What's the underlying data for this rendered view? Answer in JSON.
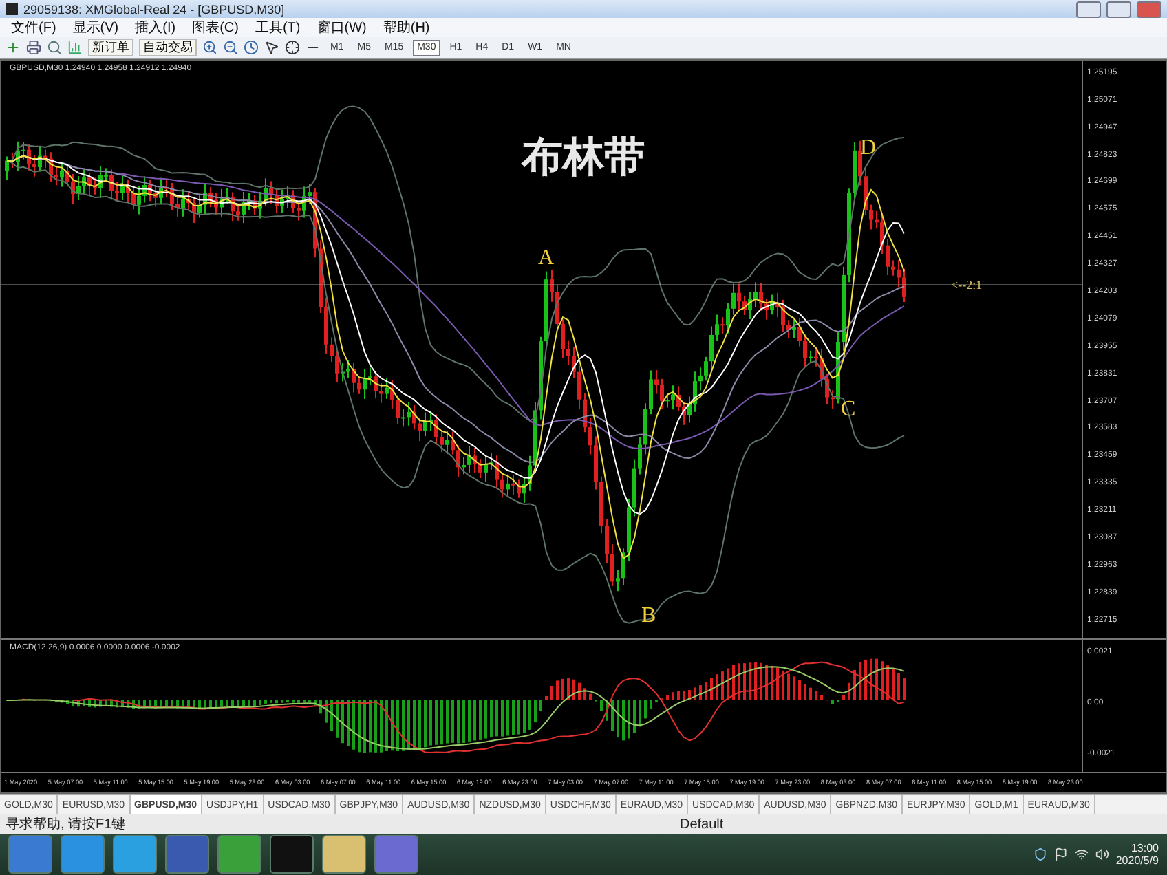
{
  "window": {
    "title": "29059138: XMGlobal-Real 24 - [GBPUSD,M30]"
  },
  "menu": [
    "文件(F)",
    "显示(V)",
    "插入(I)",
    "图表(C)",
    "工具(T)",
    "窗口(W)",
    "帮助(H)"
  ],
  "toolbar": {
    "buttons": [
      {
        "label": "新订单"
      },
      {
        "label": "自动交易"
      }
    ],
    "timeframes": [
      {
        "label": "M1",
        "selected": false
      },
      {
        "label": "M5",
        "selected": false
      },
      {
        "label": "M15",
        "selected": false
      },
      {
        "label": "M30",
        "selected": true
      },
      {
        "label": "H1",
        "selected": false
      },
      {
        "label": "H4",
        "selected": false
      },
      {
        "label": "D1",
        "selected": false
      },
      {
        "label": "W1",
        "selected": false
      },
      {
        "label": "MN",
        "selected": false
      }
    ]
  },
  "chart": {
    "header": "GBPUSD,M30 1.24940 1.24958 1.24912 1.24940",
    "title": "布林带",
    "annotations": [
      {
        "kind": "point",
        "label": "A"
      },
      {
        "kind": "point",
        "label": "B"
      },
      {
        "kind": "point",
        "label": "C"
      },
      {
        "kind": "point",
        "label": "D"
      },
      {
        "kind": "ratio",
        "label": "<--2:1"
      }
    ],
    "price_axis": [
      "1.25195",
      "1.25071",
      "1.24947",
      "1.24823",
      "1.24699",
      "1.24575",
      "1.24451",
      "1.24327",
      "1.24203",
      "1.24079",
      "1.23955",
      "1.23831",
      "1.23707",
      "1.23583",
      "1.23459",
      "1.23335",
      "1.23211",
      "1.23087",
      "1.22963",
      "1.22839",
      "1.22715"
    ],
    "indicator": {
      "header": "MACD(12,26,9) 0.0006 0.0000 0.0006 -0.0002",
      "axis": [
        "0.0021",
        "0.00",
        "-0.0021"
      ]
    },
    "time_axis": [
      "1 May 2020",
      "5 May 07:00",
      "5 May 11:00",
      "5 May 15:00",
      "5 May 19:00",
      "5 May 23:00",
      "6 May 03:00",
      "6 May 07:00",
      "6 May 11:00",
      "6 May 15:00",
      "6 May 19:00",
      "6 May 23:00",
      "7 May 03:00",
      "7 May 07:00",
      "7 May 11:00",
      "7 May 15:00",
      "7 May 19:00",
      "7 May 23:00",
      "8 May 03:00",
      "8 May 07:00",
      "8 May 11:00",
      "8 May 15:00",
      "8 May 19:00",
      "8 May 23:00"
    ]
  },
  "chart_tabs": [
    {
      "label": "GOLD,M30",
      "selected": false
    },
    {
      "label": "EURUSD,M30",
      "selected": false
    },
    {
      "label": "GBPUSD,M30",
      "selected": true
    },
    {
      "label": "USDJPY,H1",
      "selected": false
    },
    {
      "label": "USDCAD,M30",
      "selected": false
    },
    {
      "label": "GBPJPY,M30",
      "selected": false
    },
    {
      "label": "AUDUSD,M30",
      "selected": false
    },
    {
      "label": "NZDUSD,M30",
      "selected": false
    },
    {
      "label": "USDCHF,M30",
      "selected": false
    },
    {
      "label": "EURAUD,M30",
      "selected": false
    },
    {
      "label": "USDCAD,M30",
      "selected": false
    },
    {
      "label": "AUDUSD,M30",
      "selected": false
    },
    {
      "label": "GBPNZD,M30",
      "selected": false
    },
    {
      "label": "EURJPY,M30",
      "selected": false
    },
    {
      "label": "GOLD,M1",
      "selected": false
    },
    {
      "label": "EURAUD,M30",
      "selected": false
    }
  ],
  "status_bar": {
    "help": "寻求帮助, 请按F1键",
    "profile": "Default"
  },
  "taskbar": {
    "time": "13:00",
    "date": "2020/5/9"
  }
}
